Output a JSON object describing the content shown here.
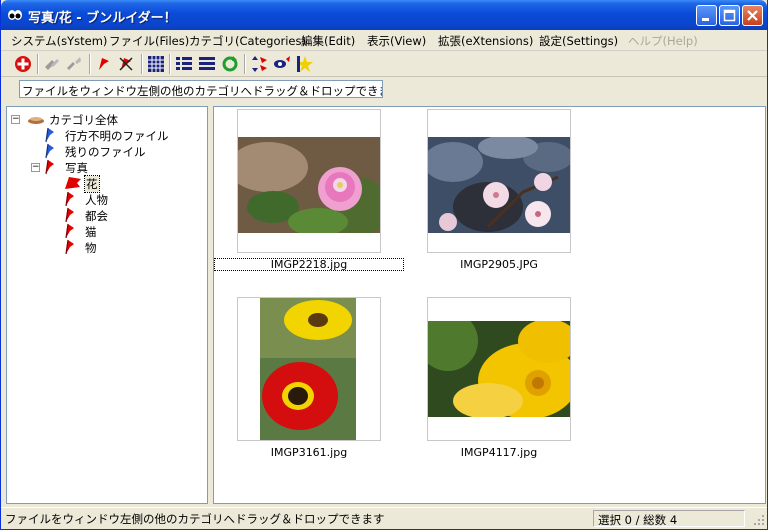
{
  "window": {
    "title": "写真/花 - ブンルイダー！"
  },
  "menu": [
    {
      "label": "システム(sYstem)",
      "disabled": false
    },
    {
      "label": "ファイル(Files)",
      "disabled": false
    },
    {
      "label": "カテゴリ(Categories)",
      "disabled": false
    },
    {
      "label": "編集(Edit)",
      "disabled": false
    },
    {
      "label": "表示(View)",
      "disabled": false
    },
    {
      "label": "拡張(eXtensions)",
      "disabled": false
    },
    {
      "label": "設定(Settings)",
      "disabled": false
    },
    {
      "label": "ヘルプ(Help)",
      "disabled": true
    }
  ],
  "toolbar": {
    "icons": [
      "add-category-icon",
      "link-icon",
      "unlink-icon",
      "flag-icon",
      "delete-flag-icon",
      "grid-view-icon",
      "list-view-icon",
      "detail-view-icon",
      "refresh-icon",
      "sort-icon",
      "find-icon",
      "star-icon"
    ]
  },
  "hint": {
    "text": "ファイルをウィンドウ左側の他のカテゴリへドラッグ＆ドロップできます"
  },
  "tree": {
    "root": "カテゴリ全体",
    "missing": "行方不明のファイル",
    "remaining": "残りのファイル",
    "photos": "写真",
    "children": [
      "花",
      "人物",
      "都会",
      "猫",
      "物"
    ]
  },
  "files": [
    {
      "name": "IMGP2218.jpg",
      "focused": true
    },
    {
      "name": "IMGP2905.JPG",
      "focused": false
    },
    {
      "name": "IMGP3161.jpg",
      "focused": false
    },
    {
      "name": "IMGP4117.jpg",
      "focused": false
    }
  ],
  "status": {
    "message": "ファイルをウィンドウ左側の他のカテゴリへドラッグ＆ドロップできます",
    "count": "選択 0 / 総数 4"
  },
  "colors": {
    "titlebar": "#0a4bd8",
    "flag_red": "#e00000",
    "flag_blue": "#2a5bd7"
  }
}
